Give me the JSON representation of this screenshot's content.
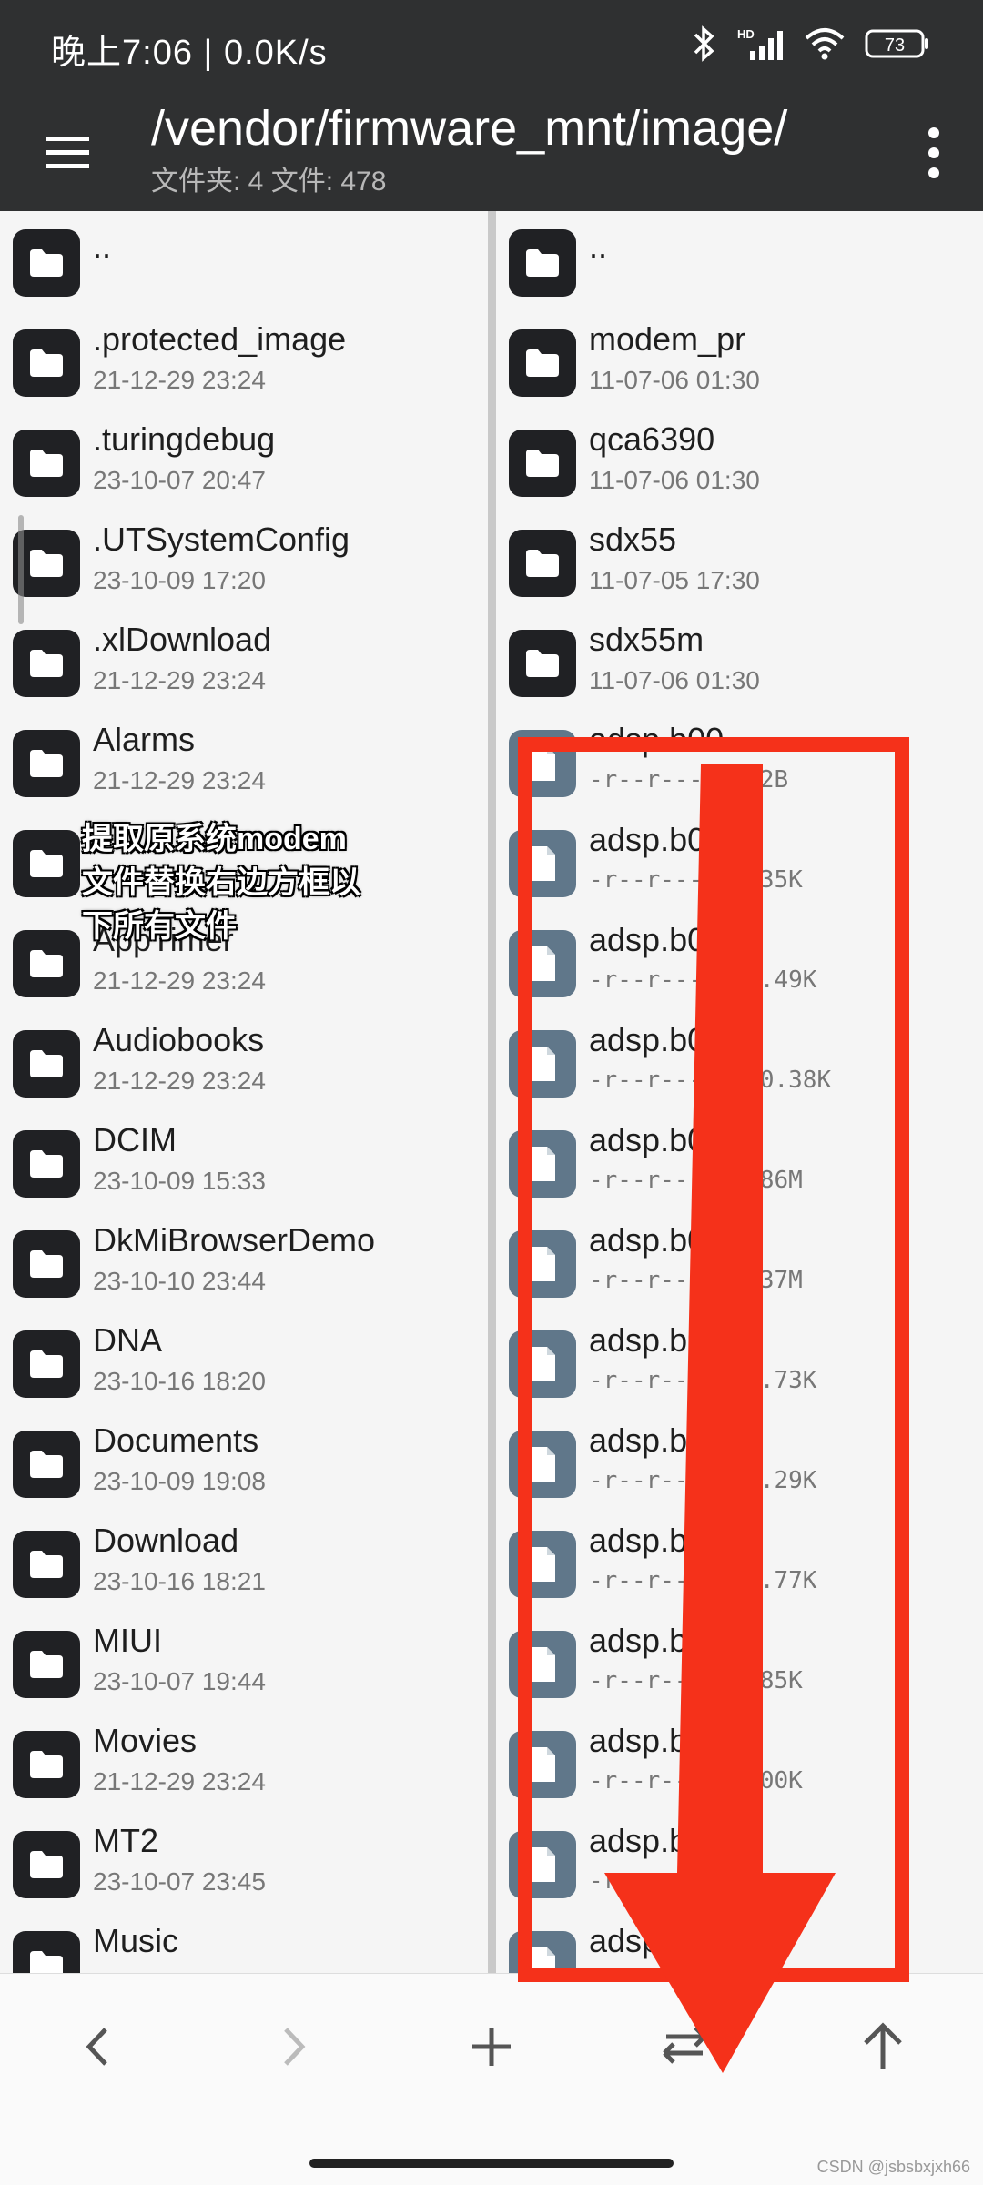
{
  "status": {
    "left": "晚上7:06 | 0.0K/s",
    "battery": "73",
    "network": "HD"
  },
  "header": {
    "path": "/vendor/firmware_mnt/image/",
    "summary": "文件夹: 4   文件: 478"
  },
  "left_pane": {
    "items": [
      {
        "name": "..",
        "date": "",
        "type": "folder"
      },
      {
        "name": ".protected_image",
        "date": "21-12-29 23:24",
        "type": "folder"
      },
      {
        "name": ".turingdebug",
        "date": "23-10-07 20:47",
        "type": "folder"
      },
      {
        "name": ".UTSystemConfig",
        "date": "23-10-09 17:20",
        "type": "folder"
      },
      {
        "name": ".xlDownload",
        "date": "21-12-29 23:24",
        "type": "folder"
      },
      {
        "name": "Alarms",
        "date": "21-12-29 23:24",
        "type": "folder"
      },
      {
        "name": "",
        "date": "",
        "type": "folder"
      },
      {
        "name": "AppTimer",
        "date": "21-12-29 23:24",
        "type": "folder"
      },
      {
        "name": "Audiobooks",
        "date": "21-12-29 23:24",
        "type": "folder"
      },
      {
        "name": "DCIM",
        "date": "23-10-09 15:33",
        "type": "folder"
      },
      {
        "name": "DkMiBrowserDemo",
        "date": "23-10-10 23:44",
        "type": "folder"
      },
      {
        "name": "DNA",
        "date": "23-10-16 18:20",
        "type": "folder"
      },
      {
        "name": "Documents",
        "date": "23-10-09 19:08",
        "type": "folder"
      },
      {
        "name": "Download",
        "date": "23-10-16 18:21",
        "type": "folder"
      },
      {
        "name": "MIUI",
        "date": "23-10-07 19:44",
        "type": "folder"
      },
      {
        "name": "Movies",
        "date": "21-12-29 23:24",
        "type": "folder"
      },
      {
        "name": "MT2",
        "date": "23-10-07 23:45",
        "type": "folder"
      },
      {
        "name": "Music",
        "date": "",
        "type": "folder"
      }
    ]
  },
  "right_pane": {
    "items": [
      {
        "name": "..",
        "meta": "",
        "type": "folder"
      },
      {
        "name": "modem_pr",
        "meta": "11-07-06 01:30",
        "type": "folder"
      },
      {
        "name": "qca6390",
        "meta": "11-07-06 01:30",
        "type": "folder"
      },
      {
        "name": "sdx55",
        "meta": "11-07-05 17:30",
        "type": "folder"
      },
      {
        "name": "sdx55m",
        "meta": "11-07-06 01:30",
        "type": "folder"
      },
      {
        "name": "adsp.b00",
        "meta": "-r--r---- 692B",
        "type": "file"
      },
      {
        "name": "adsp.b0",
        "meta": "-r--r---- 7.35K",
        "type": "file"
      },
      {
        "name": "adsp.b0",
        "meta": "-r--r---- 80.49K",
        "type": "file"
      },
      {
        "name": "adsp.b0",
        "meta": "-r--r---- 350.38K",
        "type": "file"
      },
      {
        "name": "adsp.b0",
        "meta": "-r--r---- 1.86M",
        "type": "file"
      },
      {
        "name": "adsp.b0",
        "meta": "-r--r---- 2.37M",
        "type": "file"
      },
      {
        "name": "adsp.b0",
        "meta": "-r--r---- 37.73K",
        "type": "file"
      },
      {
        "name": "adsp.b0",
        "meta": "-r--r---- 28.29K",
        "type": "file"
      },
      {
        "name": "adsp.b0",
        "meta": "-r--r---- 23.77K",
        "type": "file"
      },
      {
        "name": "adsp.b0",
        "meta": "-r--r---- 2.85K",
        "type": "file"
      },
      {
        "name": "adsp.b",
        "meta": "-r--r---- 6.00K",
        "type": "file"
      },
      {
        "name": "adsp.b",
        "meta": "-r",
        "type": "file"
      },
      {
        "name": "adsp.",
        "meta": "",
        "type": "file"
      }
    ]
  },
  "annotation": {
    "text_lines": [
      "提取原系统modem",
      "文件替换右边方框以",
      "下所有文件"
    ],
    "color": "#f5311a"
  },
  "bottom_nav": {
    "buttons": [
      "back-icon",
      "forward-icon",
      "add-icon",
      "swap-icon",
      "up-icon"
    ]
  },
  "watermark": "CSDN @jsbsbxjxh66",
  "colors": {
    "toolbar_bg": "#2f3031",
    "folder_icon": "#202124",
    "file_icon": "#60778a",
    "annotation_red": "#f5311a"
  }
}
